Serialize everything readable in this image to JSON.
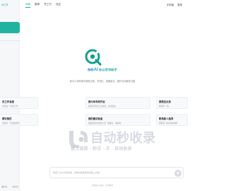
{
  "sidebar": {
    "brand": "AI工作",
    "footer_left": "用户名",
    "footer_right": "2月1日"
  },
  "nav": {
    "items": [
      "AI助",
      "推荐",
      "员工行",
      "社区"
    ],
    "right": [
      "手机版",
      "登录"
    ]
  },
  "hero": {
    "title_prefix": "你的",
    "title_ai": "AI",
    "title_mid": "办公",
    "title_suffix": "写作助手",
    "subtitle": "我可以帮你撰写周报日报、写简历、准备面试，随时为你解答问题"
  },
  "cards": [
    {
      "title": "月工作总结",
      "desc": "总结这一月的工作"
    },
    {
      "title": "我今年年终作业",
      "desc": "帮我写年终工作总结，重点突出"
    },
    {
      "title": "我是位女孩",
      "desc": "帮我写一篇"
    },
    {
      "title": "撰写简历",
      "desc": "帮我写一份求职简历"
    },
    {
      "title": "我的面试准备",
      "desc": "我面试时的自我介绍【模板】，请帮我"
    },
    {
      "title": "职场新人指导",
      "desc": "帮我写【新请求内容】"
    }
  ],
  "input": {
    "placeholder": "使用下方AI对话功能，选择功能或者直接输入内容..."
  },
  "disclaimer": "内容由AI生成，仅供参考",
  "watermark": {
    "main": "自动秒收录",
    "sub": "管上链接→秒访→次→自动收录"
  },
  "colors": {
    "accent": "#18a999",
    "hero_blue": "#1f7fd6"
  }
}
